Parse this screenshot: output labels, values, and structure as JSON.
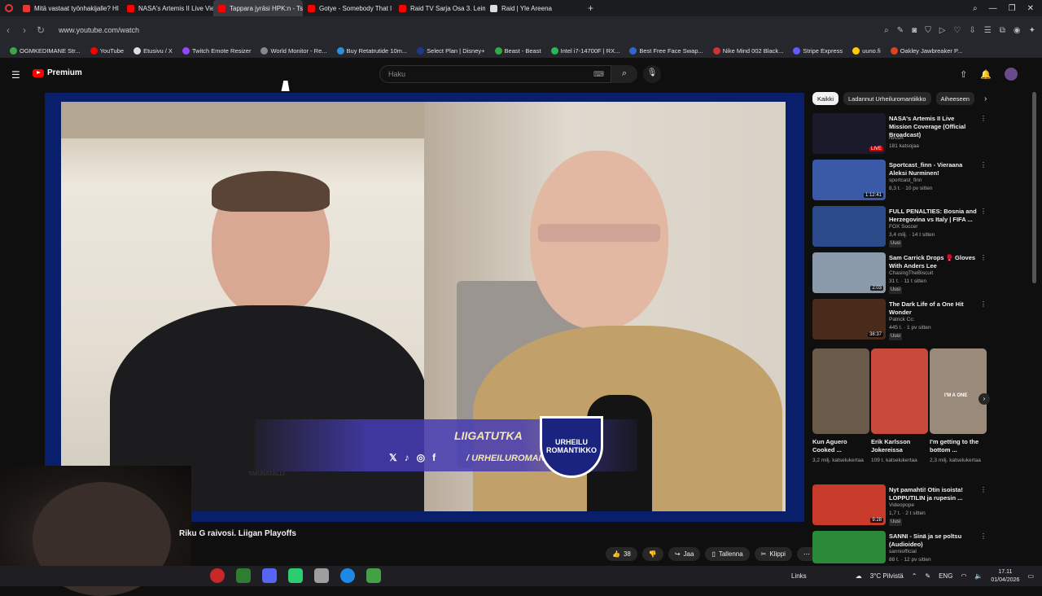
{
  "browser": {
    "tabs": [
      {
        "label": "Mitä vastaat työnhakijalle? Hl",
        "color": "#e53935",
        "active": false
      },
      {
        "label": "NASA's Artemis II Live Vie",
        "color": "#ff0000",
        "active": false
      },
      {
        "label": "Tappara jyräsi HPK:n - Ts",
        "color": "#ff0000",
        "active": true
      },
      {
        "label": "Gotye - Somebody That I",
        "color": "#ff0000",
        "active": false
      },
      {
        "label": "Raid TV Sarja Osa 3. Leim",
        "color": "#ff0000",
        "active": false
      },
      {
        "label": "Raid | Yle Areena",
        "color": "#dddddd",
        "active": false
      }
    ],
    "new_tab_label": "+",
    "url": "www.youtube.com/watch",
    "bookmarks": [
      {
        "label": "OGMKEDIMANE Str...",
        "color": "#3aa74a"
      },
      {
        "label": "YouTube",
        "color": "#ff0000"
      },
      {
        "label": "Etusivu / X",
        "color": "#dddddd"
      },
      {
        "label": "Twitch Emote Resizer",
        "color": "#9146ff"
      },
      {
        "label": "World Monitor - Re...",
        "color": "#888888"
      },
      {
        "label": "Buy Retatrutide 10m...",
        "color": "#2f8fd8"
      },
      {
        "label": "Select Plan | Disney+",
        "color": "#1d3a8a"
      },
      {
        "label": "Beast - Beast",
        "color": "#33aa44"
      },
      {
        "label": "Intel i7-14700F | RX...",
        "color": "#22bb55"
      },
      {
        "label": "Best Free Face Swap...",
        "color": "#3366cc"
      },
      {
        "label": "Nike Mind 002 Black...",
        "color": "#cc3333"
      },
      {
        "label": "Stripe Express",
        "color": "#635bff"
      },
      {
        "label": "uuno.fi",
        "color": "#ffcc00"
      },
      {
        "label": "Oakley Jawbreaker P...",
        "color": "#dd4422"
      }
    ]
  },
  "youtube": {
    "logo_label": "Premium",
    "search_placeholder": "Haku",
    "video_title": "Riku G raivosi. Liigan Playoffs",
    "overlay_title": "LIIGATUTKA",
    "overlay_handle": "/ URHEILUROMANTIKKO",
    "badge_text": "URHEILU ROMANTIKKO",
    "small_logo": "TAKINATALLI",
    "like_count": "38",
    "actions": {
      "share": "Jaa",
      "save": "Tallenna",
      "clip": "Klippi"
    },
    "chips": [
      "Kaikki",
      "Ladannut Urheiluromantiikko",
      "Aiheeseen"
    ],
    "recommendations": [
      {
        "title": "NASA's Artemis II Live Mission Coverage (Official Broadcast)",
        "channel": "NASA",
        "meta": "181 katsojaa",
        "badge": "LIVE",
        "new": "",
        "thumb": "#1a1a2a"
      },
      {
        "title": "Sportcast_finn - Vieraana Aleksi Nurminen!",
        "channel": "sportcast_finn",
        "meta": "8,3 t. · 10 pv sitten",
        "badge": "1:12:41",
        "new": "",
        "thumb": "#3a5aa8"
      },
      {
        "title": "FULL PENALTIES: Bosnia and Herzegovina vs Italy | FIFA ...",
        "channel": "FOX Soccer",
        "meta": "3,4 milj. · 14 t sitten",
        "badge": "",
        "new": "Uusi",
        "thumb": "#2a4a8a"
      },
      {
        "title": "Sam Carrick Drops 🥊 Gloves With Anders Lee",
        "channel": "ChasingTheBiscuit",
        "meta": "31 t. · 11 t sitten",
        "badge": "2:03",
        "new": "Uusi",
        "thumb": "#8a9aaa"
      },
      {
        "title": "The Dark Life of a One Hit Wonder",
        "channel": "Patrick Cc:",
        "meta": "445 t. · 1 pv sitten",
        "badge": "38:37",
        "new": "Uusi",
        "thumb": "#4a2a1a"
      }
    ],
    "shorts": [
      {
        "title": "Kun Aguero Cooked ...",
        "meta": "3,2 milj. katselukertaa",
        "thumb": "#6a5a4a"
      },
      {
        "title": "Erik Karlsson Jokereissa",
        "meta": "109 t. katselukertaa",
        "thumb": "#c84a3a"
      },
      {
        "title": "I'm getting to the bottom ...",
        "meta": "2,3 milj. katselukertaa",
        "thumb": "#9a8a7a"
      }
    ],
    "shorts_overlay": [
      "I'M A ONE"
    ],
    "more_recs": [
      {
        "title": "Nyt pamahti! Otin isoista! LOPPUTILIN ja rupesin ...",
        "channel": "Videopope",
        "meta": "1,7 t. · 2 t sitten",
        "badge": "9:28",
        "new": "Uusi",
        "thumb": "#c83a2a"
      },
      {
        "title": "SANNI - Sinä ja se poltsu (Audioideo)",
        "channel": "sanniofficial",
        "meta": "88 t. · 12 pv sitten",
        "badge": "",
        "new": "",
        "thumb": "#2a8a3a"
      }
    ]
  },
  "taskbar": {
    "links_label": "Links",
    "weather": "3°C  Pilvistä",
    "lang": "ENG",
    "time": "17.11",
    "date": "01/04/2026"
  }
}
